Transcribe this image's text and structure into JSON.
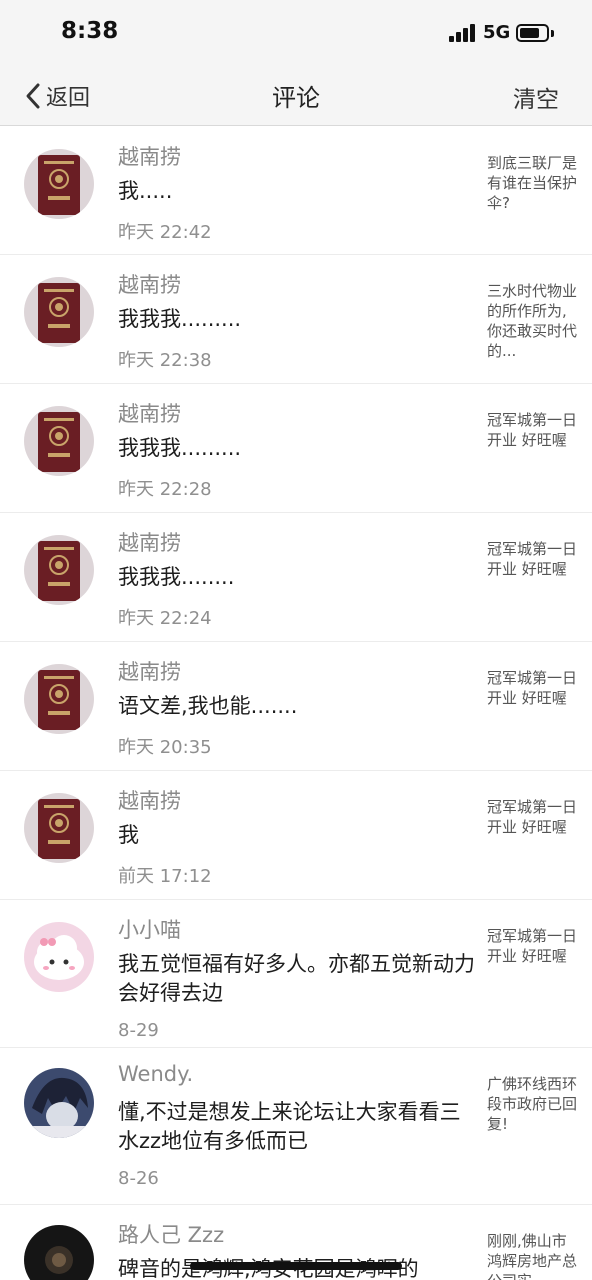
{
  "status": {
    "time": "8:38",
    "network": "5G",
    "battery_level": 0.75
  },
  "nav": {
    "back_label": "返回",
    "title": "评论",
    "clear_label": "清空"
  },
  "comments": [
    {
      "avatar": "passport-icon",
      "name": "越南捞",
      "text": "我.....",
      "time": "昨天 22:42",
      "post": "到底三联厂是有谁在当保护伞?"
    },
    {
      "avatar": "passport-icon",
      "name": "越南捞",
      "text": "我我我.........",
      "time": "昨天 22:38",
      "post": "三水时代物业的所作所为,你还敢买时代的..."
    },
    {
      "avatar": "passport-icon",
      "name": "越南捞",
      "text": "我我我.........",
      "time": "昨天 22:28",
      "post": "冠军城第一日开业 好旺喔"
    },
    {
      "avatar": "passport-icon",
      "name": "越南捞",
      "text": "我我我........",
      "time": "昨天 22:24",
      "post": "冠军城第一日开业 好旺喔"
    },
    {
      "avatar": "passport-icon",
      "name": "越南捞",
      "text": "语文差,我也能.......",
      "time": "昨天 20:35",
      "post": "冠军城第一日开业 好旺喔"
    },
    {
      "avatar": "passport-icon",
      "name": "越南捞",
      "text": "我",
      "time": "前天 17:12",
      "post": "冠军城第一日开业 好旺喔"
    },
    {
      "avatar": "cloud-avatar-icon",
      "name": "小小喵",
      "text": "我五觉恒福有好多人。亦都五觉新动力会好得去边",
      "time": "8-29",
      "post": "冠军城第一日开业 好旺喔"
    },
    {
      "avatar": "anime-avatar-icon",
      "name": "Wendy.",
      "text": "懂,不过是想发上来论坛让大家看看三水zz地位有多低而已",
      "time": "8-26",
      "post": "广佛环线西环段市政府已回复!"
    },
    {
      "avatar": "dark-avatar-icon",
      "name": "路人己 Zzz",
      "text": "碑音的是鸿辉,鸿安花园是鸿晖的",
      "time": "",
      "post": "刚刚,佛山市鸿辉房地产总公司实"
    }
  ]
}
